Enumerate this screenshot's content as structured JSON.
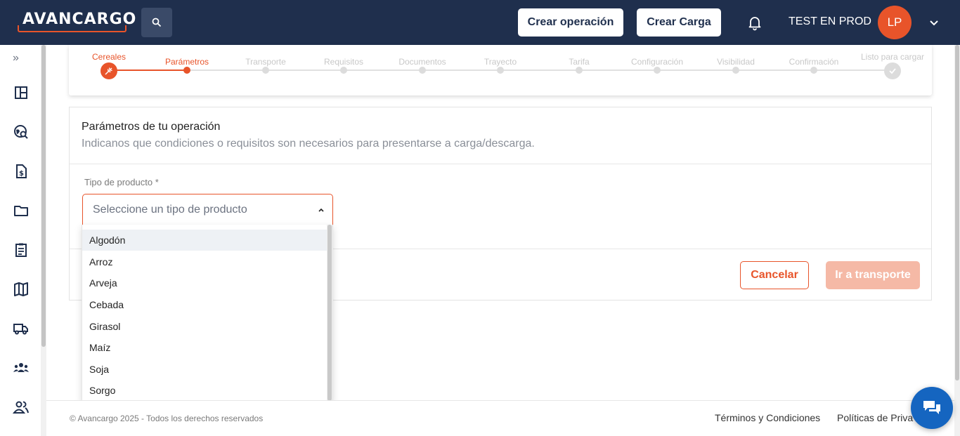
{
  "header": {
    "logo_text": "AVANCARGO",
    "create_operation_label": "Crear operación",
    "create_load_label": "Crear Carga",
    "username": "TEST EN PROD",
    "avatar_initials": "LP"
  },
  "sidebar": {
    "expand_icon": "»",
    "items": [
      {
        "name": "dashboard-icon"
      },
      {
        "name": "globe-search-icon"
      },
      {
        "name": "invoice-icon"
      },
      {
        "name": "folder-icon"
      },
      {
        "name": "clipboard-icon"
      },
      {
        "name": "map-icon"
      },
      {
        "name": "truck-icon"
      },
      {
        "name": "groups-icon"
      },
      {
        "name": "users-icon"
      }
    ]
  },
  "stepper": {
    "steps": [
      {
        "label": "Cereales",
        "state": "done"
      },
      {
        "label": "Parámetros",
        "state": "active"
      },
      {
        "label": "Transporte",
        "state": "pending"
      },
      {
        "label": "Requisitos",
        "state": "pending"
      },
      {
        "label": "Documentos",
        "state": "pending"
      },
      {
        "label": "Trayecto",
        "state": "pending"
      },
      {
        "label": "Tarifa",
        "state": "pending"
      },
      {
        "label": "Configuración",
        "state": "pending"
      },
      {
        "label": "Visibilidad",
        "state": "pending"
      },
      {
        "label": "Confirmación",
        "state": "pending"
      },
      {
        "label": "Listo para cargar",
        "state": "pending"
      }
    ]
  },
  "form": {
    "title": "Parámetros de tu operación",
    "subtitle": "Indicanos que condiciones o requisitos son necesarios para presentarse a carga/descarga.",
    "product_type_label": "Tipo de producto *",
    "product_type_placeholder": "Seleccione un tipo de producto",
    "cancel_label": "Cancelar",
    "next_label": "Ir a transporte"
  },
  "dropdown": {
    "options": [
      "Algodón",
      "Arroz",
      "Arveja",
      "Cebada",
      "Girasol",
      "Maíz",
      "Soja",
      "Sorgo"
    ]
  },
  "footer": {
    "copyright": "© Avancargo 2025 - Todos los derechos reservados",
    "terms": "Términos y Condiciones",
    "privacy": "Políticas de Priva"
  },
  "colors": {
    "navy": "#1f2f4d",
    "accent": "#e8542a",
    "chat": "#1565c0"
  }
}
